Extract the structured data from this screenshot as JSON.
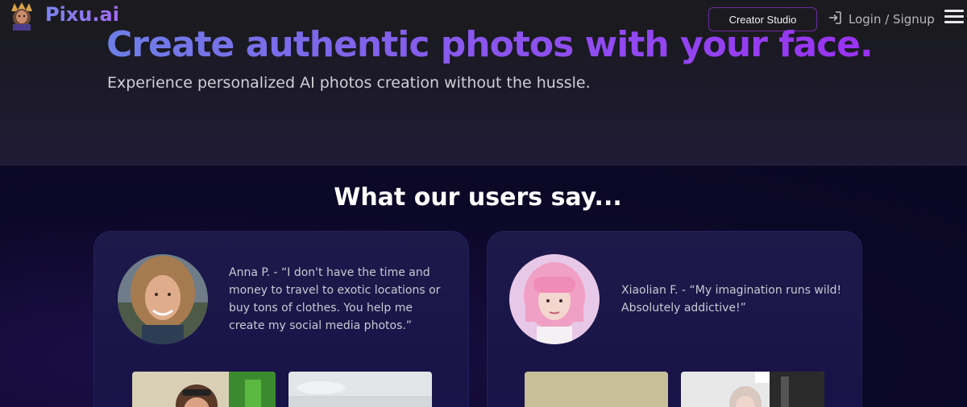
{
  "header": {
    "brand": "Pixu.ai",
    "creator_button": "Creator Studio",
    "login_label": "Login / Signup"
  },
  "hero": {
    "title": "Create authentic photos with your face.",
    "subtitle": "Experience personalized AI photos creation without the hussle."
  },
  "testimonials": {
    "title": "What our users say...",
    "items": [
      {
        "quote": "Anna P. - “I don't have the time and\nmoney to travel to exotic locations or\nbuy tons of clothes. You help me\ncreate my social media photos.”"
      },
      {
        "quote": "Xiaolian F. - “My imagination runs wild!\nAbsolutely addictive!”"
      }
    ]
  },
  "colors": {
    "header_bg": "#1b1b1f",
    "accent_purple": "#9a32f2",
    "accent_blue": "#6d7fe6",
    "section_bg": "#0c0828",
    "card_bg": "#1d1a4a"
  }
}
